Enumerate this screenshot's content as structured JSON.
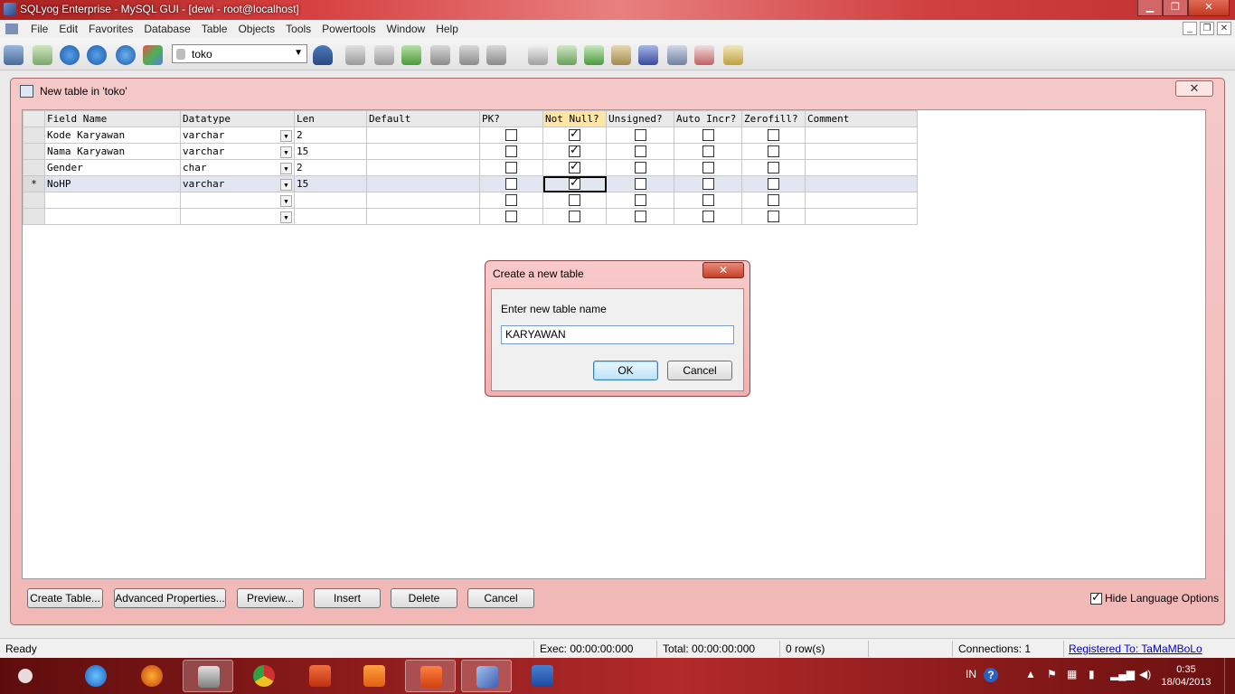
{
  "window": {
    "title": "SQLyog Enterprise - MySQL GUI - [dewi - root@localhost]"
  },
  "menu": [
    "File",
    "Edit",
    "Favorites",
    "Database",
    "Table",
    "Objects",
    "Tools",
    "Powertools",
    "Window",
    "Help"
  ],
  "toolbar": {
    "database": "toko"
  },
  "child_window": {
    "title": "New table in 'toko'",
    "columns": [
      "Field Name",
      "Datatype",
      "Len",
      "Default",
      "PK?",
      "Not Null?",
      "Unsigned?",
      "Auto Incr?",
      "Zerofill?",
      "Comment"
    ],
    "rows": [
      {
        "marker": "",
        "field": "Kode Karyawan",
        "type": "varchar",
        "len": "2",
        "default": "",
        "pk": false,
        "notnull": true,
        "unsigned": false,
        "autoinc": false,
        "zerofill": false,
        "comment": ""
      },
      {
        "marker": "",
        "field": "Nama Karyawan",
        "type": "varchar",
        "len": "15",
        "default": "",
        "pk": false,
        "notnull": true,
        "unsigned": false,
        "autoinc": false,
        "zerofill": false,
        "comment": ""
      },
      {
        "marker": "",
        "field": "Gender",
        "type": "char",
        "len": "2",
        "default": "",
        "pk": false,
        "notnull": true,
        "unsigned": false,
        "autoinc": false,
        "zerofill": false,
        "comment": ""
      },
      {
        "marker": "*",
        "field": "NoHP",
        "type": "varchar",
        "len": "15",
        "default": "",
        "pk": false,
        "notnull": true,
        "unsigned": false,
        "autoinc": false,
        "zerofill": false,
        "comment": ""
      },
      {
        "marker": "",
        "field": "",
        "type": "",
        "len": "",
        "default": "",
        "pk": false,
        "notnull": false,
        "unsigned": false,
        "autoinc": false,
        "zerofill": false,
        "comment": ""
      },
      {
        "marker": "",
        "field": "",
        "type": "",
        "len": "",
        "default": "",
        "pk": false,
        "notnull": false,
        "unsigned": false,
        "autoinc": false,
        "zerofill": false,
        "comment": ""
      }
    ],
    "buttons": {
      "create_table": "Create Table...",
      "advanced": "Advanced Properties...",
      "preview": "Preview...",
      "insert": "Insert",
      "delete": "Delete",
      "cancel": "Cancel"
    },
    "hide_language_options": "Hide Language Options"
  },
  "dialog": {
    "title": "Create a new table",
    "label": "Enter new table name",
    "value": "KARYAWAN",
    "ok": "OK",
    "cancel": "Cancel"
  },
  "statusbar": {
    "ready": "Ready",
    "exec": "Exec: 00:00:00:000",
    "total": "Total: 00:00:00:000",
    "rows": "0 row(s)",
    "connections": "Connections: 1",
    "registered": "Registered To: TaMaMBoLo"
  },
  "taskbar": {
    "language": "IN",
    "time": "0:35",
    "date": "18/04/2013"
  }
}
